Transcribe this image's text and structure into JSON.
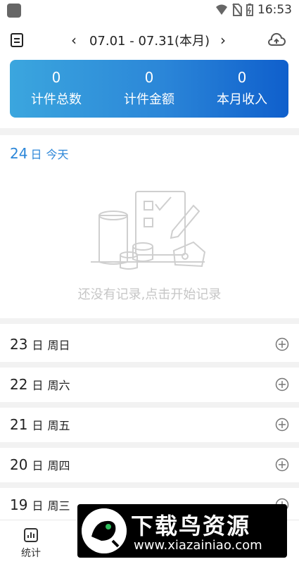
{
  "status_bar": {
    "time": "16:53"
  },
  "header": {
    "prev_label": "‹",
    "next_label": "›",
    "date_range": "07.01 - 07.31(本月)"
  },
  "stats": [
    {
      "value": "0",
      "label": "计件总数"
    },
    {
      "value": "0",
      "label": "计件金额"
    },
    {
      "value": "0",
      "label": "本月收入"
    }
  ],
  "today": {
    "day": "24",
    "unit": "日",
    "tag": "今天",
    "empty_message": "还没有记录,点击开始记录"
  },
  "days": [
    {
      "day": "23",
      "unit": "日",
      "weekday": "周日"
    },
    {
      "day": "22",
      "unit": "日",
      "weekday": "周六"
    },
    {
      "day": "21",
      "unit": "日",
      "weekday": "周五"
    },
    {
      "day": "20",
      "unit": "日",
      "weekday": "周四"
    },
    {
      "day": "19",
      "unit": "日",
      "weekday": "周三"
    }
  ],
  "bottom_nav": {
    "stats_label": "统计"
  },
  "watermark": {
    "brand": "下载鸟资源",
    "url": "www.xiazainiao.com"
  },
  "colors": {
    "accent": "#2b86d8",
    "card_start": "#3ba6de",
    "card_end": "#0f5fcc"
  }
}
